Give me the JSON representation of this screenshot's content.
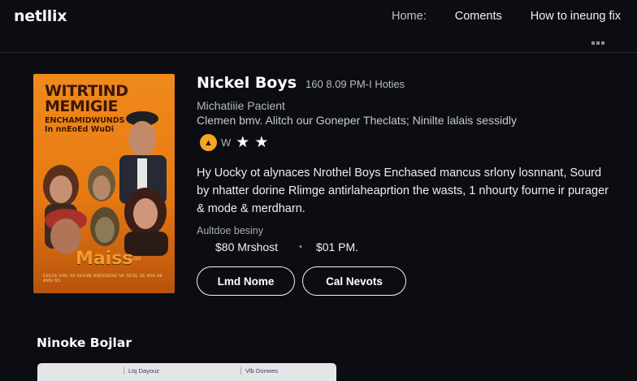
{
  "app": {
    "logo": "netllix"
  },
  "nav": {
    "items": [
      "Home:",
      "Coments",
      "How to ineung fix"
    ]
  },
  "poster": {
    "title": "WITRTIND MEMIGIE",
    "subtitle": "ENCHAMIDWUNDS\nIn nnEoEd WuDi",
    "brand": "Maiss",
    "small": "Cas",
    "credits": "EEESE ERE SE AEEME ANEEEENE NE SESE SE NSE AE AMN NS"
  },
  "movie": {
    "title": "Nickel Boys",
    "meta": "160 8.09 PM-I Hoties",
    "subtitle": "Michatiiie Pacient",
    "tagline": "Clemen bmv. Alitch our Goneper Theclats; Ninilte lalais sessidly",
    "rating_label": "W",
    "stars": 2,
    "synopsis": "Hy Uocky ot alynaces Nrothel Boys Enchased mancus srlony losnnant, Sourd by nhatter dorine Rlimge antirlaheaprtion the wasts, 1 nhourty fourne ir purager & mode & merdharn.",
    "availability_label": "Aultdoe besiny",
    "times": [
      "$80 Mrshost",
      "$01 PM."
    ],
    "separator": "•"
  },
  "buttons": {
    "primary": "Lmd Nome",
    "secondary": "Cal Nevots"
  },
  "section": {
    "title": "Ninoke Bojlar"
  },
  "table": {
    "headers": [
      "Ltq Dayouz",
      "Vlb Donwes"
    ]
  },
  "colors": {
    "background": "#0b0d12",
    "accent": "#f5a623",
    "poster": "#e77a13"
  }
}
